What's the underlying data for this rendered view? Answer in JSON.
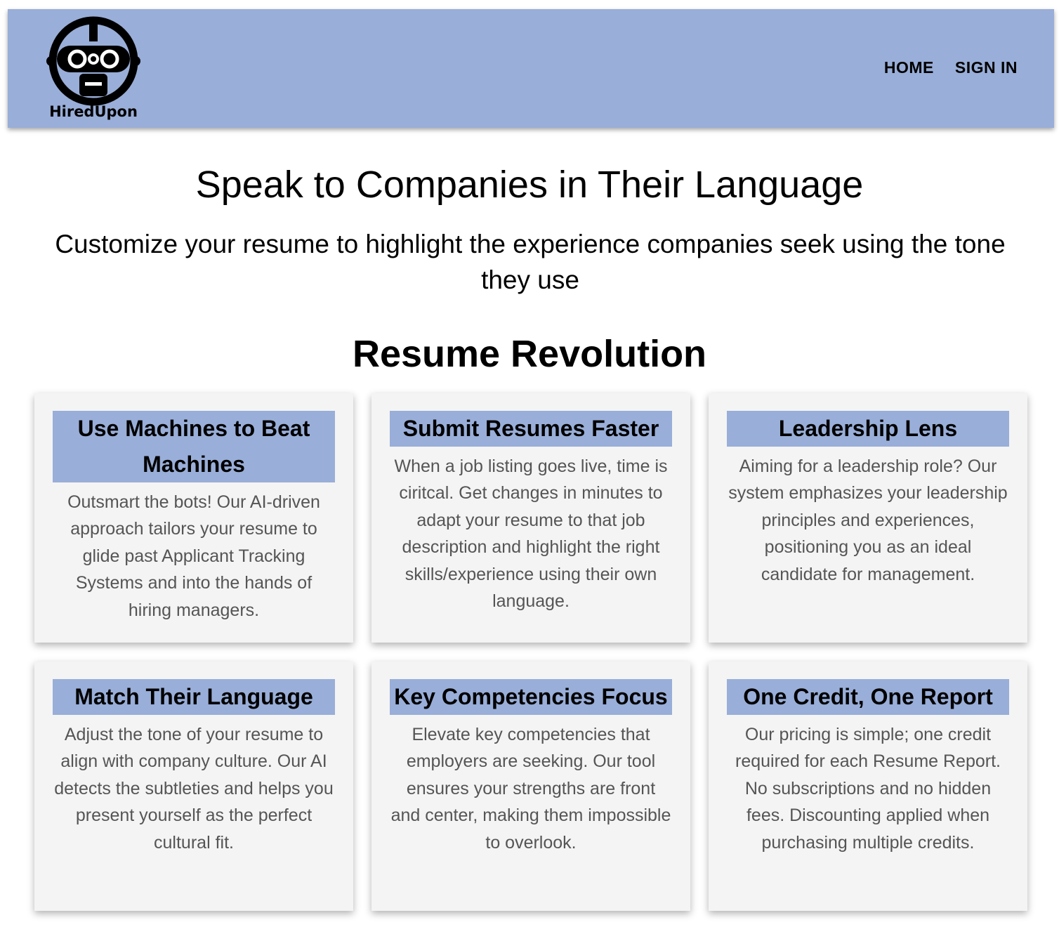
{
  "header": {
    "brand": "HiredUpon",
    "nav": [
      {
        "label": "HOME"
      },
      {
        "label": "SIGN IN"
      }
    ],
    "colors": {
      "background": "#99aed8"
    }
  },
  "hero": {
    "title": "Speak to Companies in Their Language",
    "subtitle": "Customize your resume to highlight the experience companies seek using the tone they use"
  },
  "features": {
    "title": "Resume Revolution",
    "cards": [
      {
        "title": "Use Machines to Beat Machines",
        "body": "Outsmart the bots! Our AI-driven approach tailors your resume to glide past Applicant Tracking Systems and into the hands of hiring managers."
      },
      {
        "title": "Submit Resumes Faster",
        "body": "When a job listing goes live, time is ciritcal. Get changes in minutes to adapt your resume to that job description and highlight the right skills/experience using their own language."
      },
      {
        "title": "Leadership Lens",
        "body": "Aiming for a leadership role? Our system emphasizes your leadership principles and experiences, positioning you as an ideal candidate for management."
      },
      {
        "title": "Match Their Language",
        "body": "Adjust the tone of your resume to align with company culture. Our AI detects the subtleties and helps you present yourself as the perfect cultural fit."
      },
      {
        "title": "Key Competencies Focus",
        "body": "Elevate key competencies that employers are seeking. Our tool ensures your strengths are front and center, making them impossible to overlook."
      },
      {
        "title": "One Credit, One Report",
        "body": "Our pricing is simple; one credit required for each Resume Report. No subscriptions and no hidden fees. Discounting applied when purchasing multiple credits."
      }
    ]
  }
}
